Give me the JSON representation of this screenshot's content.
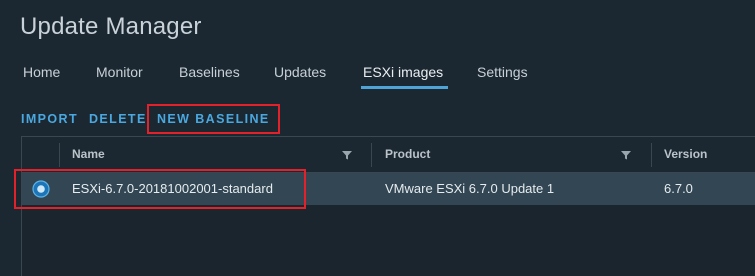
{
  "title": "Update Manager",
  "tabs": [
    {
      "label": "Home"
    },
    {
      "label": "Monitor"
    },
    {
      "label": "Baselines"
    },
    {
      "label": "Updates"
    },
    {
      "label": "ESXi images"
    },
    {
      "label": "Settings"
    }
  ],
  "active_tab": "ESXi images",
  "actions": {
    "import": "IMPORT",
    "delete": "DELETE",
    "new_baseline": "NEW BASELINE"
  },
  "grid": {
    "columns": [
      {
        "label": "Name"
      },
      {
        "label": "Product"
      },
      {
        "label": "Version"
      }
    ],
    "rows": [
      {
        "name": "ESXi-6.7.0-20181002001-standard",
        "product": "VMware ESXi 6.7.0 Update 1",
        "version": "6.7.0",
        "selected": true
      }
    ]
  },
  "colors": {
    "accent": "#4fa3d6",
    "link": "#4aa8e0",
    "highlight": "#e3212b",
    "selected_row": "#324653",
    "background": "#1c2831"
  },
  "icons": {
    "filter": "filter-funnel-icon",
    "row_select": "radio-selected-icon"
  }
}
